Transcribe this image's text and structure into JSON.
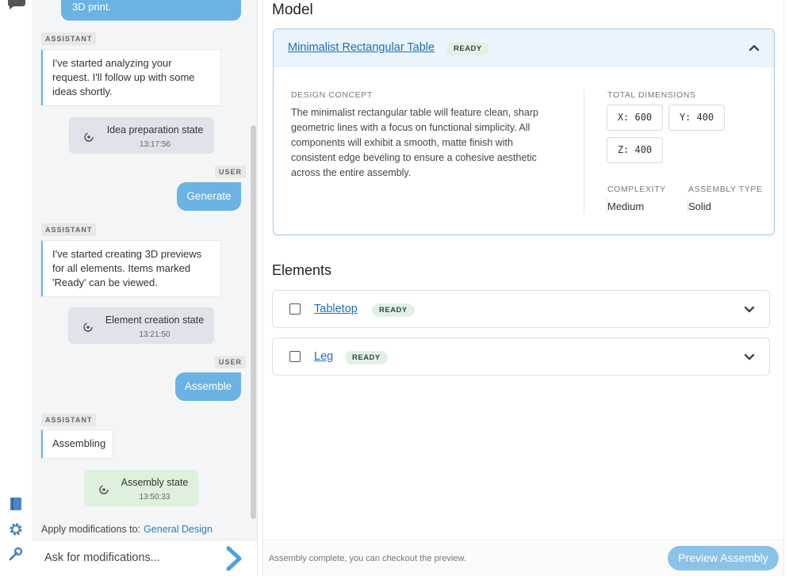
{
  "chat": {
    "top_user_message": "3D print.",
    "tags": {
      "assistant": "ASSISTANT",
      "user": "USER"
    },
    "assistant_messages": [
      "I've started analyzing your request. I'll follow up with some ideas shortly.",
      "I've started creating 3D previews for all elements. Items marked 'Ready' can be viewed.",
      "Assembling"
    ],
    "states": [
      {
        "label": "Idea preparation state",
        "time": "13:17:56"
      },
      {
        "label": "Element creation state",
        "time": "13:21:50"
      },
      {
        "label": "Assembly state",
        "time": "13:50:33"
      }
    ],
    "user_buttons": [
      "Generate",
      "Assemble"
    ],
    "apply_label": "Apply modifications to:",
    "apply_target": "General Design",
    "input_placeholder": "Ask for modifications..."
  },
  "main": {
    "model_heading": "Model",
    "model": {
      "title": "Minimalist Rectangular Table",
      "status": "READY",
      "design_concept_label": "DESIGN CONCEPT",
      "design_concept": "The minimalist rectangular table will feature clean, sharp geometric lines with a focus on functional simplicity. All components will exhibit a smooth, matte finish with consistent edge beveling to ensure a cohesive aesthetic across the entire assembly.",
      "total_dimensions_label": "TOTAL DIMENSIONS",
      "dimensions": {
        "x": "X: 600",
        "y": "Y: 400",
        "z": "Z: 400"
      },
      "complexity_label": "COMPLEXITY",
      "complexity": "Medium",
      "assembly_type_label": "ASSEMBLY TYPE",
      "assembly_type": "Solid"
    },
    "elements_heading": "Elements",
    "elements": [
      {
        "name": "Tabletop",
        "status": "READY"
      },
      {
        "name": "Leg",
        "status": "READY"
      }
    ],
    "footer_text": "Assembly complete, you can checkout the preview.",
    "preview_button": "Preview Assembly"
  },
  "colors": {
    "accent": "#6ab3e3",
    "link": "#1f6fb8",
    "ready_badge_bg": "#e3f1e3",
    "assembly_state_bg": "#ddf1dc"
  },
  "icons": [
    "chat-icon",
    "book-icon",
    "gear-icon",
    "wrench-icon",
    "spinner-icon",
    "send-arrow-icon",
    "chevron-up-icon",
    "chevron-down-icon"
  ]
}
